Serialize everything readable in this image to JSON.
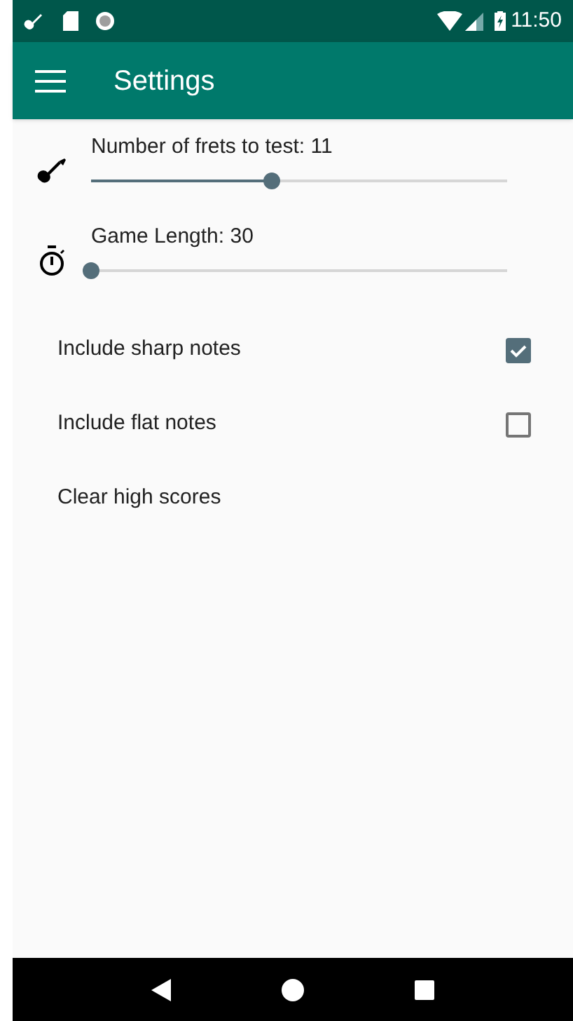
{
  "status_bar": {
    "time": "11:50"
  },
  "app_bar": {
    "title": "Settings"
  },
  "settings": [
    {
      "kind": "slider",
      "label": "Number of frets to test: 11",
      "level": 0.434
    },
    {
      "kind": "slider",
      "label": "Game Length: 30",
      "level": 0
    },
    {
      "kind": "checkbox",
      "label": "Include sharp notes",
      "checked": true
    },
    {
      "kind": "checkbox",
      "label": "Include flat notes",
      "checked": false
    },
    {
      "kind": "action",
      "label": "Clear high scores"
    }
  ]
}
